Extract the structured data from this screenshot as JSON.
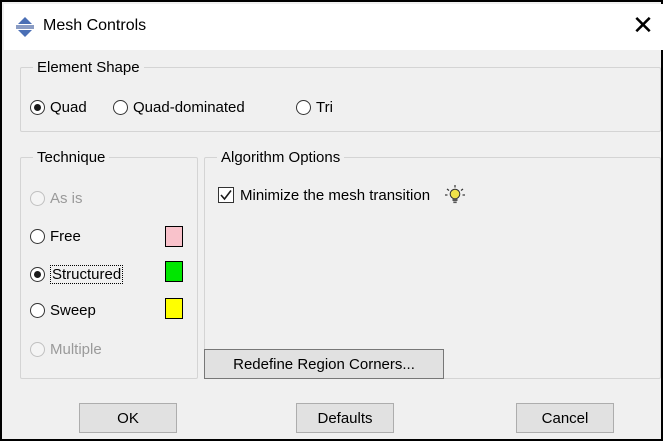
{
  "window": {
    "title": "Mesh Controls",
    "close_symbol": "✕"
  },
  "element_shape": {
    "legend": "Element Shape",
    "options": [
      {
        "label": "Quad",
        "selected": true
      },
      {
        "label": "Quad-dominated",
        "selected": false
      },
      {
        "label": "Tri",
        "selected": false
      }
    ]
  },
  "technique": {
    "legend": "Technique",
    "options": [
      {
        "label": "As is",
        "selected": false,
        "enabled": false,
        "color": ""
      },
      {
        "label": "Free",
        "selected": false,
        "enabled": true,
        "color": "#f9c2cb"
      },
      {
        "label": "Structured",
        "selected": true,
        "enabled": true,
        "color": "#00e600"
      },
      {
        "label": "Sweep",
        "selected": false,
        "enabled": true,
        "color": "#ffff00"
      },
      {
        "label": "Multiple",
        "selected": false,
        "enabled": false,
        "color": ""
      }
    ]
  },
  "algorithm": {
    "legend": "Algorithm Options",
    "minimize_label": "Minimize the mesh transition",
    "minimize_checked": true,
    "tip_icon": "lightbulb-icon",
    "redefine_label": "Redefine Region Corners..."
  },
  "buttons": {
    "ok": "OK",
    "defaults": "Defaults",
    "cancel": "Cancel"
  }
}
